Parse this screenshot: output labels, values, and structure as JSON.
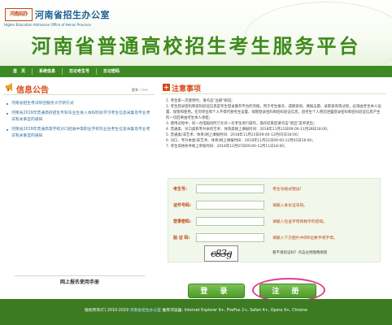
{
  "header": {
    "logo_mark": "河南招办",
    "logo_text": "河南省招生办公室",
    "logo_en": "Higher Education Admission Office of Henan Province",
    "title": "河南省普通高校招生考生服务平台"
  },
  "nav": {
    "items": [
      "首　页",
      "系统信息",
      "忘记考生号",
      "忘记密码"
    ]
  },
  "announcements": {
    "title": "信息公告",
    "more": "更多 :::>>",
    "items": [
      "河南省招生考试综合服务大厅新方式",
      "河南省2019年普通高校招生专科毕业生进入本科阶段学习考生信息采集及专业考试有关事宜的通知",
      "河南省2019年普通高等学校对口招收中等职业学校毕业生考生信息采集及专业考试有关事宜的通知"
    ],
    "manual": "网上报名使用手册"
  },
  "notice": {
    "title": "注意事项",
    "items": [
      "1. 考生第一次使用时，请点击\"注册\"按钮；",
      "2. 考生登录密码和密码验证信息是考生登录服务平台的凭据，用于考生报名、成绩查询、填报志愿、录取查询等过程，必须由考生本人设置、保管和使用。任何单位和个人不得代替考生设置、保管登录密码和密码验证信息，因考生个人原因泄露登录密码和密码验证信息产生的一切后果由考生本人承担；",
      "3. 使用过程中，同一台电脑同时只允许一名考生进行操作，操作结束后请点击\"退出\"菜单退出；",
      "4. 普通类、对口类和专升本的艺术、体育类网上填报时间：2018年11月22日09:00-11月28日18:00；",
      "5. 普通类(非艺术、体育)网上填报时间：2018年11月22日09:00-12月05日18:00；",
      "6. 对口、专升本类(非艺术、体育)网上填报时间：2018年11月22日09:00-12月05日18:00；",
      "7. 考生资格条件网上审核时间：2018年12月07日09:00-12月11日18:00；"
    ]
  },
  "form": {
    "fields": [
      {
        "label": "考生号:",
        "value": "",
        "hint": "考生号格式错误!"
      },
      {
        "label": "证件号码:",
        "value": "",
        "hint": "请输入身份证号码。"
      },
      {
        "label": "登录密码:",
        "value": "",
        "hint": "请输入包含字母和数字的密码。"
      },
      {
        "label": "验 证 码:",
        "value": "",
        "hint": "请输入下方图片中的6位数字或字母。"
      }
    ],
    "captcha_text": "c83g",
    "captcha_hint": "看不清验证码？点击左侧图像刷新"
  },
  "buttons": {
    "login": "登 录",
    "register": "注 册"
  },
  "footer": {
    "copyright": "版权所有(C) 2010-2019",
    "link": "河南省招生办公室",
    "browsers": "推荐浏览器: Internet Explorer 9+, FireFox 2+, Safari 4+, Opera 9+, Chrome"
  },
  "colors": {
    "brand_green": "#3d8a25",
    "title_green": "#3f8a1d",
    "accent_red": "#d94a1a",
    "highlight_circle": "#e23b8c"
  }
}
